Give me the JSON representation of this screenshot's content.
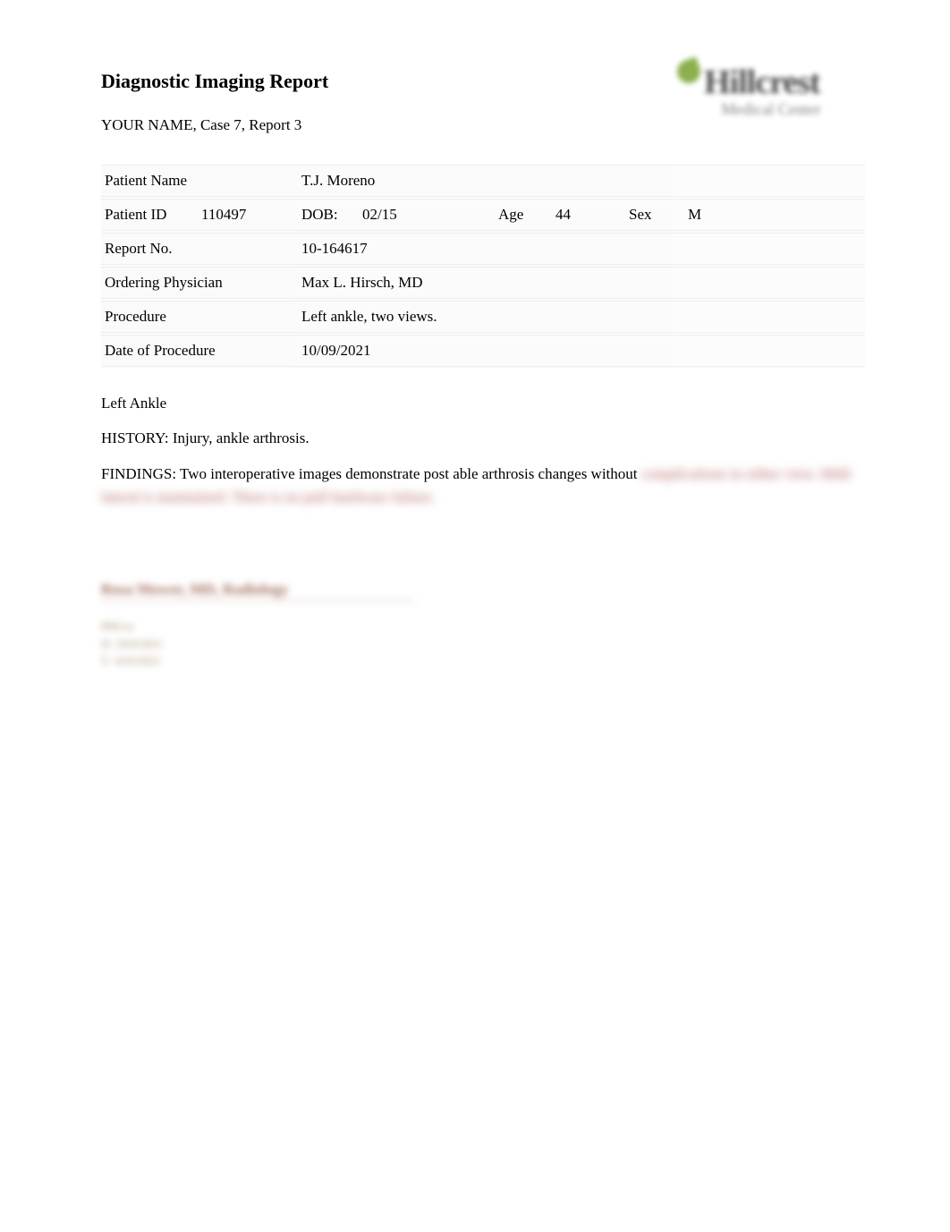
{
  "header": {
    "title": "Diagnostic Imaging Report",
    "subtitle": "YOUR NAME, Case 7, Report 3",
    "logo_top": "Hillcrest",
    "logo_sub": "Medical Center"
  },
  "patient": {
    "name_label": "Patient Name",
    "name_value": "T.J. Moreno",
    "id_label": "Patient ID",
    "id_value": "110497",
    "dob_label": "DOB:",
    "dob_value": "02/15",
    "age_label": "Age",
    "age_value": "44",
    "sex_label": "Sex",
    "sex_value": "M",
    "report_no_label": "Report No.",
    "report_no_value": "10-164617",
    "physician_label": "Ordering Physician",
    "physician_value": "Max L. Hirsch, MD",
    "procedure_label": "Procedure",
    "procedure_value": "Left ankle, two views.",
    "date_label": "Date of Procedure",
    "date_value": "10/09/2021"
  },
  "body": {
    "section_title": "Left Ankle",
    "history": "HISTORY: Injury, ankle arthrosis.",
    "findings_visible": "FINDINGS: Two interoperative images demonstrate post able arthrosis changes without",
    "findings_blurred_1": "complications in either view. Mild lateral is maintained. There is no pull hardware",
    "findings_blurred_2": "failure."
  },
  "signature": {
    "name": "Rosa Mower, MD, Radiology",
    "line1": "RM:xx",
    "line2": "D: 10/9/2021",
    "line3": "T: 10/9/2021"
  }
}
